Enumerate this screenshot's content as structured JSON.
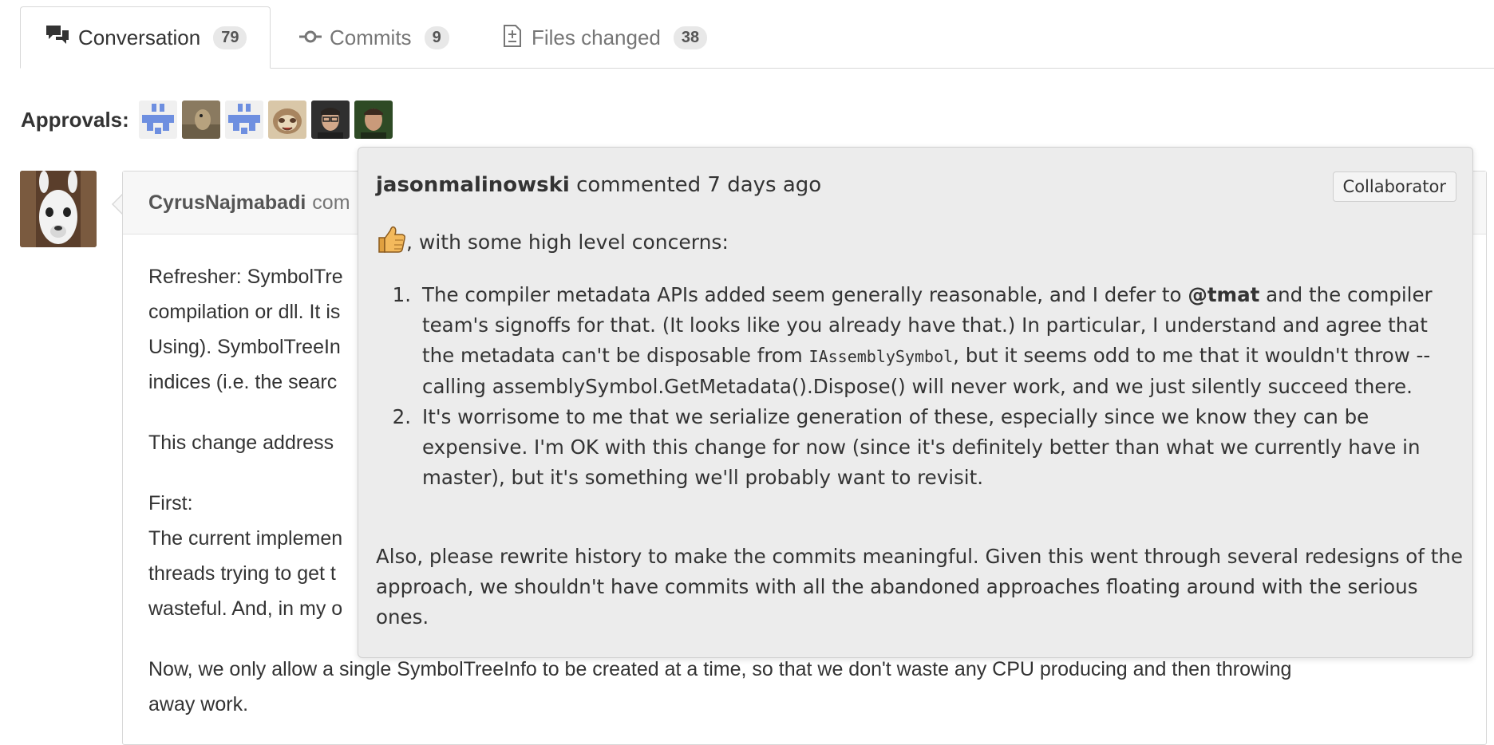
{
  "tabs": [
    {
      "label": "Conversation",
      "count": "79",
      "icon": "comment-discussion-icon"
    },
    {
      "label": "Commits",
      "count": "9",
      "icon": "git-commit-icon"
    },
    {
      "label": "Files changed",
      "count": "38",
      "icon": "file-diff-icon"
    }
  ],
  "approvals": {
    "label": "Approvals:"
  },
  "comment": {
    "author": "CyrusNajmabadi",
    "action": "com",
    "lines": [
      "Refresher: SymbolTre",
      "compilation or dll. It is",
      "Using). SymbolTreeIn",
      "indices (i.e. the searc",
      "This change address",
      "First:",
      "The current implemen",
      "threads trying to get t",
      "wasteful. And, in my o",
      "Now, we only allow a single SymbolTreeInfo to be created at a time, so that we don't waste any CPU producing and then throwing",
      "away work."
    ]
  },
  "popover": {
    "author": "jasonmalinowski",
    "action": "commented 7 days ago",
    "badge": "Collaborator",
    "intro": ", with some high level concerns:",
    "items": [
      {
        "num": "1.",
        "a": "The compiler metadata APIs added seem generally reasonable, and I defer to ",
        "mention": "@tmat",
        "b": " and the compiler team's signoffs for that. (It looks like you already have that.) In particular, I understand and agree that the metadata can't be disposable from ",
        "code": "IAssemblySymbol",
        "c": ", but it seems odd to me that it wouldn't throw -- calling assemblySymbol.GetMetadata().Dispose() will never work, and we just silently succeed there."
      },
      {
        "num": "2.",
        "text": "It's worrisome to me that we serialize generation of these, especially since we know they can be expensive. I'm OK with this change for now (since it's definitely better than what we currently have in master), but it's something we'll probably want to revisit."
      }
    ],
    "closing": "Also, please rewrite history to make the commits meaningful. Given this went through several redesigns of the approach, we shouldn't have commits with all the abandoned approaches floating around with the serious ones."
  },
  "colors": {
    "tab_border": "#d8d8d8",
    "popover_bg": "#ececec",
    "counter_bg": "#e8e8e8"
  }
}
